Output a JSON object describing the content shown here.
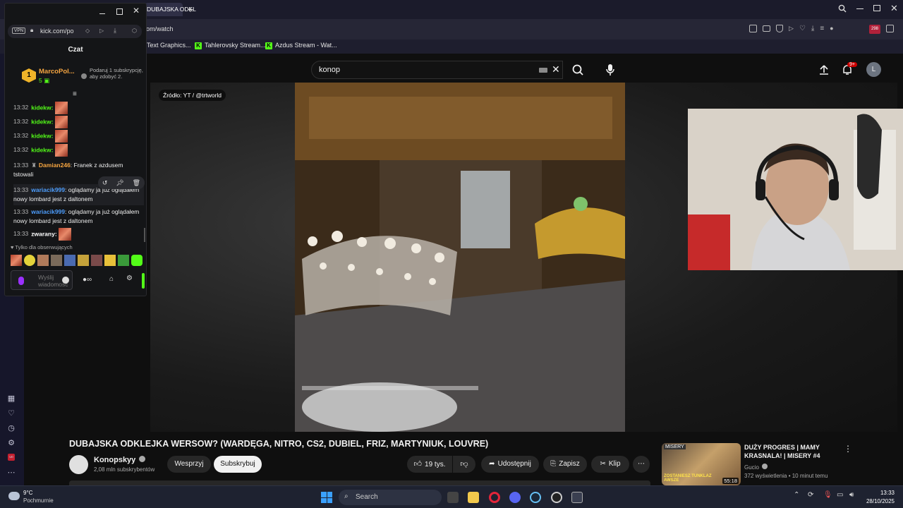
{
  "browser": {
    "tab_title": "DUBAJSKA ODKL",
    "url": "om/watch",
    "popup_url": "kick.com/po",
    "vpn_label": "VPN",
    "bookmarks": [
      "Text Graphics...",
      "Tahlerovsky Stream...",
      "Azdus Stream - Wat..."
    ],
    "badge_count": "298"
  },
  "kick": {
    "header": "Czat",
    "pinned_user": "MarcoPol...",
    "pinned_rank": "1",
    "pinned_count": "5",
    "gift_text": "Podaruj 1 subskrypcję, aby zdobyć 2.",
    "messages": [
      {
        "time": "13:32",
        "user": "kidekw:",
        "text": ""
      },
      {
        "time": "13:32",
        "user": "kidekw:",
        "text": ""
      },
      {
        "time": "13:32",
        "user": "kidekw:",
        "text": ""
      },
      {
        "time": "13:32",
        "user": "kidekw:",
        "text": ""
      },
      {
        "time": "13:33",
        "user": "Damian246",
        "text": ": Franek z azdusem tstowali"
      },
      {
        "time": "13:33",
        "user": "wariacik999",
        "text": ": oglądamy ja już oglądałem nowy lombard jest z daltonem"
      },
      {
        "time": "13:33",
        "user": "wariacik999",
        "text": ": oglądamy ja już oglądałem nowy lombard jest z daltonem"
      },
      {
        "time": "13:33",
        "user": "zwarany:",
        "text": ""
      }
    ],
    "followers_only": "Tylko dla obserwujących",
    "input_placeholder": "Wyślij wiadomość"
  },
  "youtube": {
    "search_value": "konop",
    "notification_badge": "9+",
    "avatar_letter": "L",
    "source_caption": "Źródło: YT / @trtworld",
    "video_title": "DUBAJSKA ODKLEJKA WERSOW? (WARDĘGA, NITRO, CS2, DUBIEL, FRIZ, MARTYNIUK, LOUVRE)",
    "channel_name": "Konopskyy",
    "subscribers": "2,08 mln subskrybentów",
    "support_label": "Wesprzyj",
    "subscribe_label": "Subskrybuj",
    "likes": "19 tys.",
    "share_label": "Udostępnij",
    "save_label": "Zapisz",
    "clip_label": "Klip",
    "recommended": {
      "title": "DUŻY PROGRES | MAMY KRASNALA! | MISERY #4",
      "channel": "Gucio",
      "meta": "372 wyświetlenia • 10 minut temu",
      "duration": "55:18",
      "thumb_text": "ZOSTANIESZ TUNKLAZ AWSZE",
      "thumb_label": "MISERY"
    }
  },
  "taskbar": {
    "temperature": "9°C",
    "weather": "Pochmurnie",
    "search_label": "Search",
    "time": "13:33",
    "date": "28/10/2025"
  }
}
